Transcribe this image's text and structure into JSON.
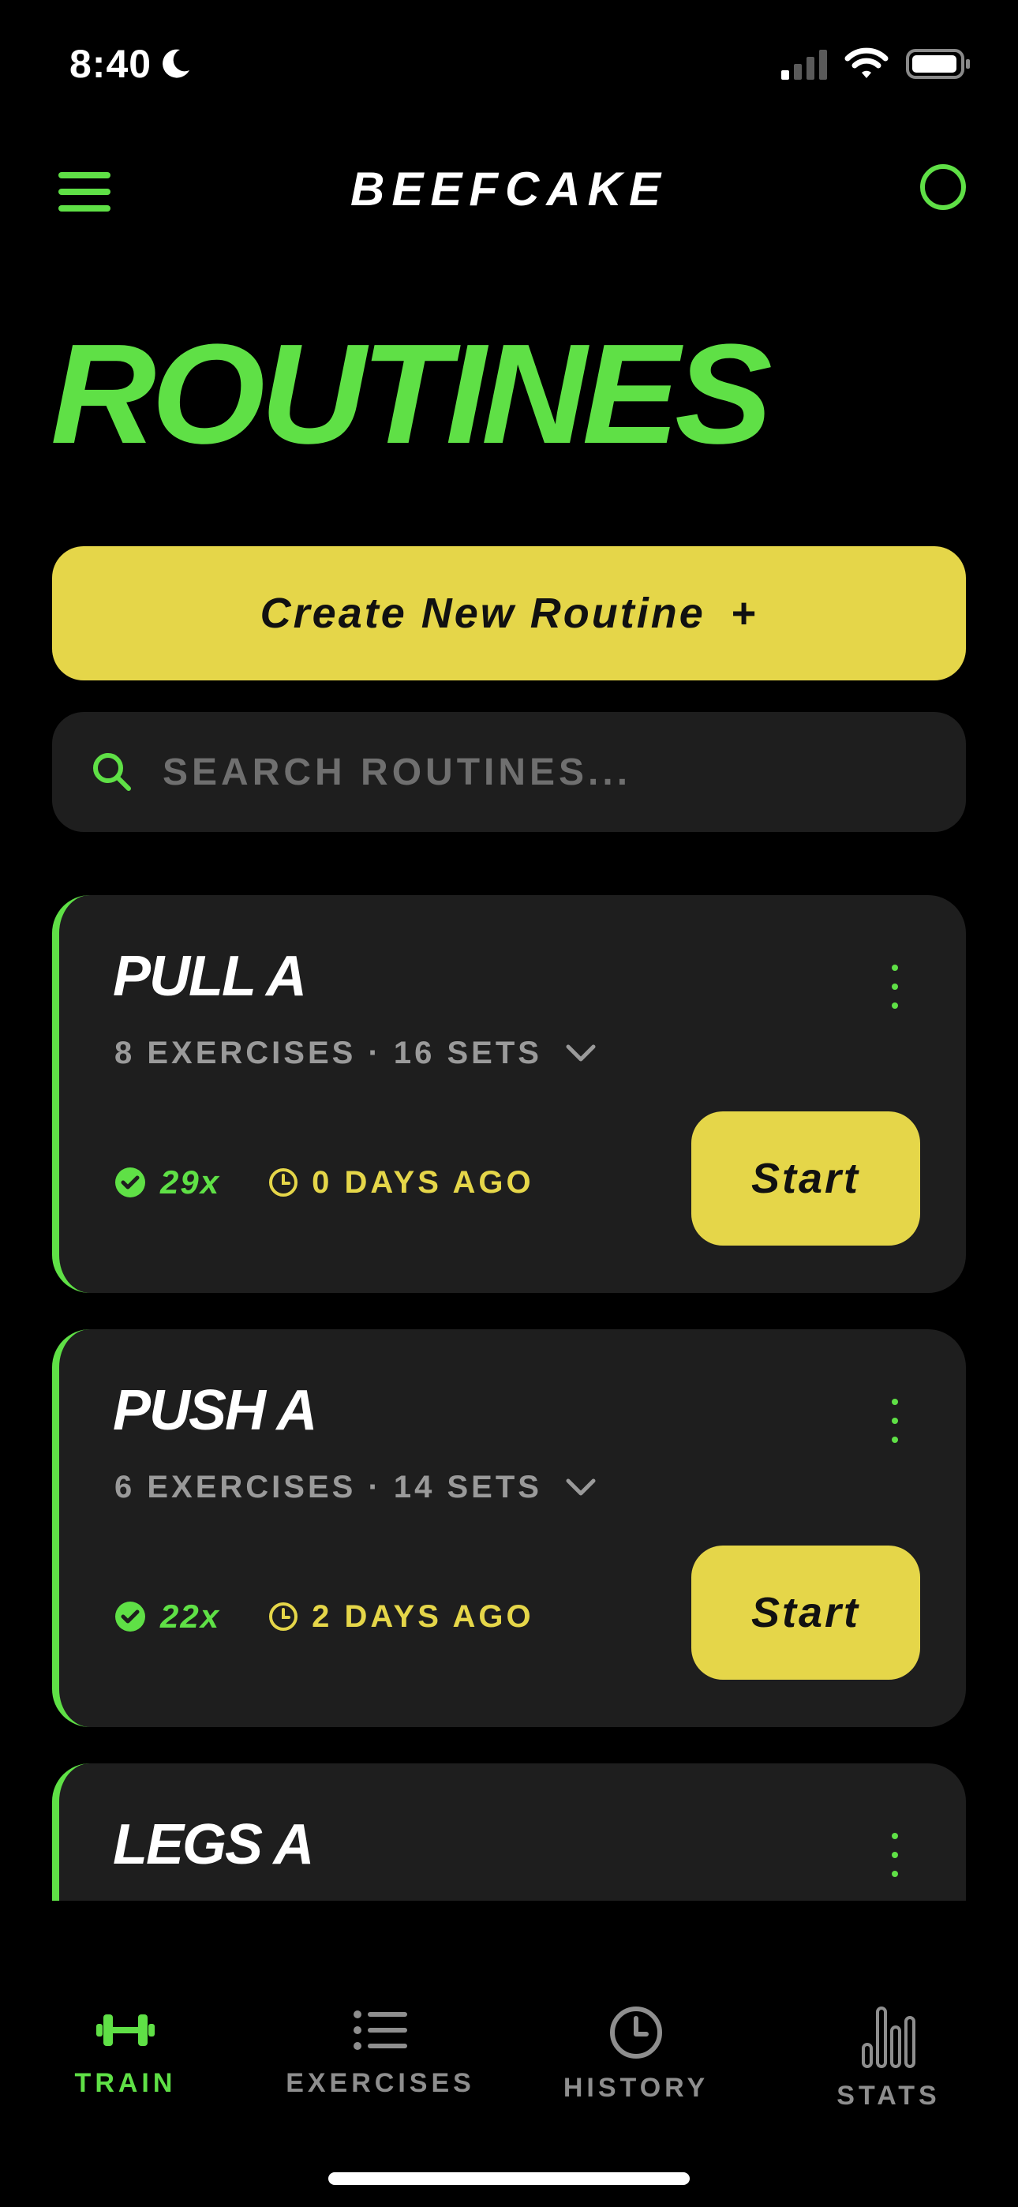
{
  "status_bar": {
    "time": "8:40"
  },
  "header": {
    "title": "BEEFCAKE"
  },
  "page": {
    "title": "ROUTINES"
  },
  "create_button": {
    "label": "Create New Routine",
    "plus": "+"
  },
  "search": {
    "placeholder": "SEARCH ROUTINES..."
  },
  "routines": [
    {
      "name": "PULL A",
      "meta": "8 EXERCISES · 16 SETS",
      "count": "29x",
      "last": "0 DAYS AGO",
      "start_label": "Start"
    },
    {
      "name": "PUSH A",
      "meta": "6 EXERCISES · 14 SETS",
      "count": "22x",
      "last": "2 DAYS AGO",
      "start_label": "Start"
    },
    {
      "name": "LEGS A"
    }
  ],
  "tabs": [
    {
      "label": "TRAIN",
      "icon": "dumbbell-icon",
      "active": true
    },
    {
      "label": "EXERCISES",
      "icon": "list-icon",
      "active": false
    },
    {
      "label": "HISTORY",
      "icon": "clock-icon",
      "active": false
    },
    {
      "label": "STATS",
      "icon": "bar-chart-icon",
      "active": false
    }
  ],
  "colors": {
    "accent_green": "#5fe046",
    "accent_yellow": "#e5d649",
    "card_bg": "#1e1e1e",
    "background": "#000000"
  }
}
